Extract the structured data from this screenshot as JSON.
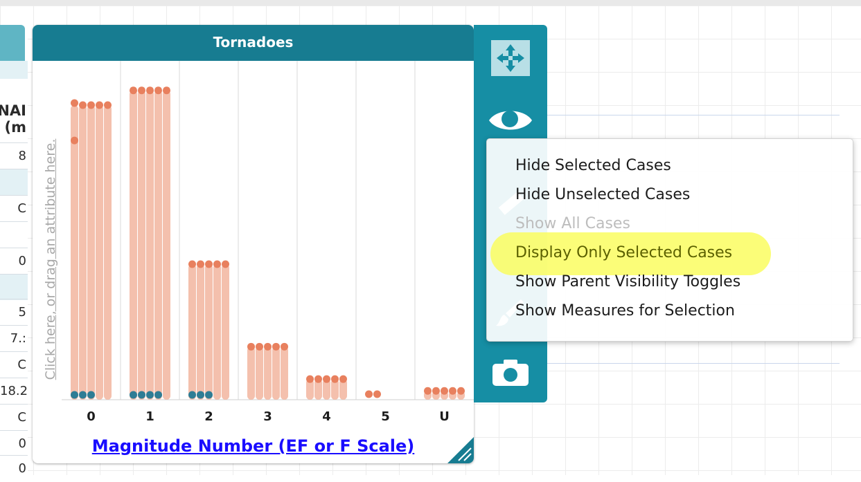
{
  "table": {
    "column_header_lines": [
      "NAI",
      "(m"
    ],
    "cells": [
      "8",
      "C",
      "0",
      "5",
      "7.:",
      "C",
      "18.2",
      "C",
      "0",
      "0"
    ]
  },
  "graph": {
    "title": "Tornadoes",
    "y_axis_prompt": "Click here, or drag an attribute here.",
    "x_axis_label": "Magnitude Number (EF or F Scale)"
  },
  "chart_data": {
    "type": "dotplot",
    "title": "Tornadoes",
    "xlabel": "Magnitude Number (EF or F Scale)",
    "ylabel": "",
    "categories": [
      "0",
      "1",
      "2",
      "3",
      "4",
      "5",
      "U"
    ],
    "dot_stack_heights": [
      1,
      1.05,
      0.46,
      0.18,
      0.07,
      0.01,
      0.03
    ],
    "selected_dot_counts": [
      3,
      4,
      3,
      0,
      0,
      0,
      0
    ],
    "colors": {
      "unselected": "#e8805e",
      "selected": "#2e7d95",
      "bars": "#f3b9a4"
    }
  },
  "toolbar": {
    "tools": [
      "move-arrows-icon",
      "eye-icon",
      "ruler-icon",
      "paint-brush-icon",
      "camera-icon"
    ]
  },
  "menu": {
    "items": [
      {
        "label": "Hide Selected Cases",
        "state": "enabled"
      },
      {
        "label": "Hide Unselected Cases",
        "state": "enabled"
      },
      {
        "label": "Show All Cases",
        "state": "disabled"
      },
      {
        "label": "Display Only Selected Cases",
        "state": "highlighted"
      },
      {
        "label": "Show Parent Visibility Toggles",
        "state": "enabled"
      },
      {
        "label": "Show Measures for Selection",
        "state": "enabled"
      }
    ]
  }
}
